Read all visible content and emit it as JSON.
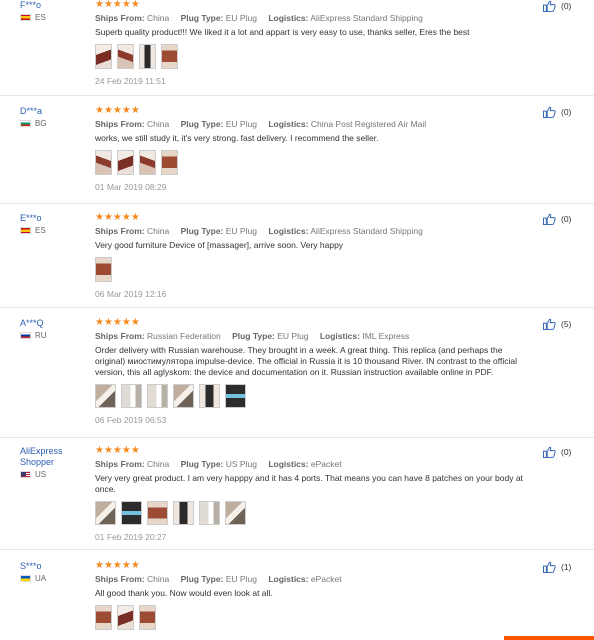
{
  "reviews": [
    {
      "user": "F***o",
      "country": "ES",
      "flag": "es-flag",
      "stars": "★★★★★",
      "ships_label": "Ships From:",
      "ships_from": "China",
      "plug_label": "Plug Type:",
      "plug_type": "EU Plug",
      "logistics_label": "Logistics:",
      "logistics": "AliExpress Standard Shipping",
      "text": "Superb quality product!!! We liked it a lot and appart is very easy to use, thanks seller, Eres the best",
      "photo_count": 4,
      "date": "24 Feb 2019 11:51",
      "likes": "(0)"
    },
    {
      "user": "D***a",
      "country": "BG",
      "flag": "bg-flag",
      "stars": "★★★★★",
      "ships_label": "Ships From:",
      "ships_from": "China",
      "plug_label": "Plug Type:",
      "plug_type": "EU Plug",
      "logistics_label": "Logistics:",
      "logistics": "China Post Registered Air Mail",
      "text": "works, we still study it, it's very strong. fast delivery. I recommend the seller.",
      "photo_count": 4,
      "date": "01 Mar 2019 08:29",
      "likes": "(0)"
    },
    {
      "user": "E***o",
      "country": "ES",
      "flag": "es-flag",
      "stars": "★★★★★",
      "ships_label": "Ships From:",
      "ships_from": "China",
      "plug_label": "Plug Type:",
      "plug_type": "EU Plug",
      "logistics_label": "Logistics:",
      "logistics": "AliExpress Standard Shipping",
      "text": "Very good furniture Device of [massager], arrive soon. Very happy",
      "photo_count": 1,
      "date": "06 Mar 2019 12:16",
      "likes": "(0)"
    },
    {
      "user": "A***Q",
      "country": "RU",
      "flag": "ru-flag",
      "stars": "★★★★★",
      "ships_label": "Ships From:",
      "ships_from": "Russian Federation",
      "plug_label": "Plug Type:",
      "plug_type": "EU Plug",
      "logistics_label": "Logistics:",
      "logistics": "IML Express",
      "text": "Order delivery with Russian warehouse. They brought in a week. A great thing. This replica (and perhaps the original) миостимулятора impulse-device. The official in Russia it is 10 thousand River. IN contrast to the official version, this all aglyskom: the device and documentation on it. Russian instruction available online in PDF.",
      "photo_count": 6,
      "date": "06 Feb 2019 06:53",
      "likes": "(5)"
    },
    {
      "user": "AliExpress Shopper",
      "country": "US",
      "flag": "us-flag",
      "stars": "★★★★★",
      "ships_label": "Ships From:",
      "ships_from": "China",
      "plug_label": "Plug Type:",
      "plug_type": "US Plug",
      "logistics_label": "Logistics:",
      "logistics": "ePacket",
      "text": "Very very great product. I am very happpy and it has 4 ports. That means you can have 8 patches on your body at once.",
      "photo_count": 6,
      "date": "01 Feb 2019 20:27",
      "likes": "(0)"
    },
    {
      "user": "S***o",
      "country": "UA",
      "flag": "ua-flag",
      "stars": "★★★★★",
      "ships_label": "Ships From:",
      "ships_from": "China",
      "plug_label": "Plug Type:",
      "plug_type": "EU Plug",
      "logistics_label": "Logistics:",
      "logistics": "ePacket",
      "text": "All good thank you. Now would even look at all.",
      "photo_count": 3,
      "date": "",
      "likes": "(1)"
    }
  ],
  "colors": {
    "accent": "#f58a1f",
    "username": "#2a5db0",
    "like_icon": "#2a5db0"
  }
}
